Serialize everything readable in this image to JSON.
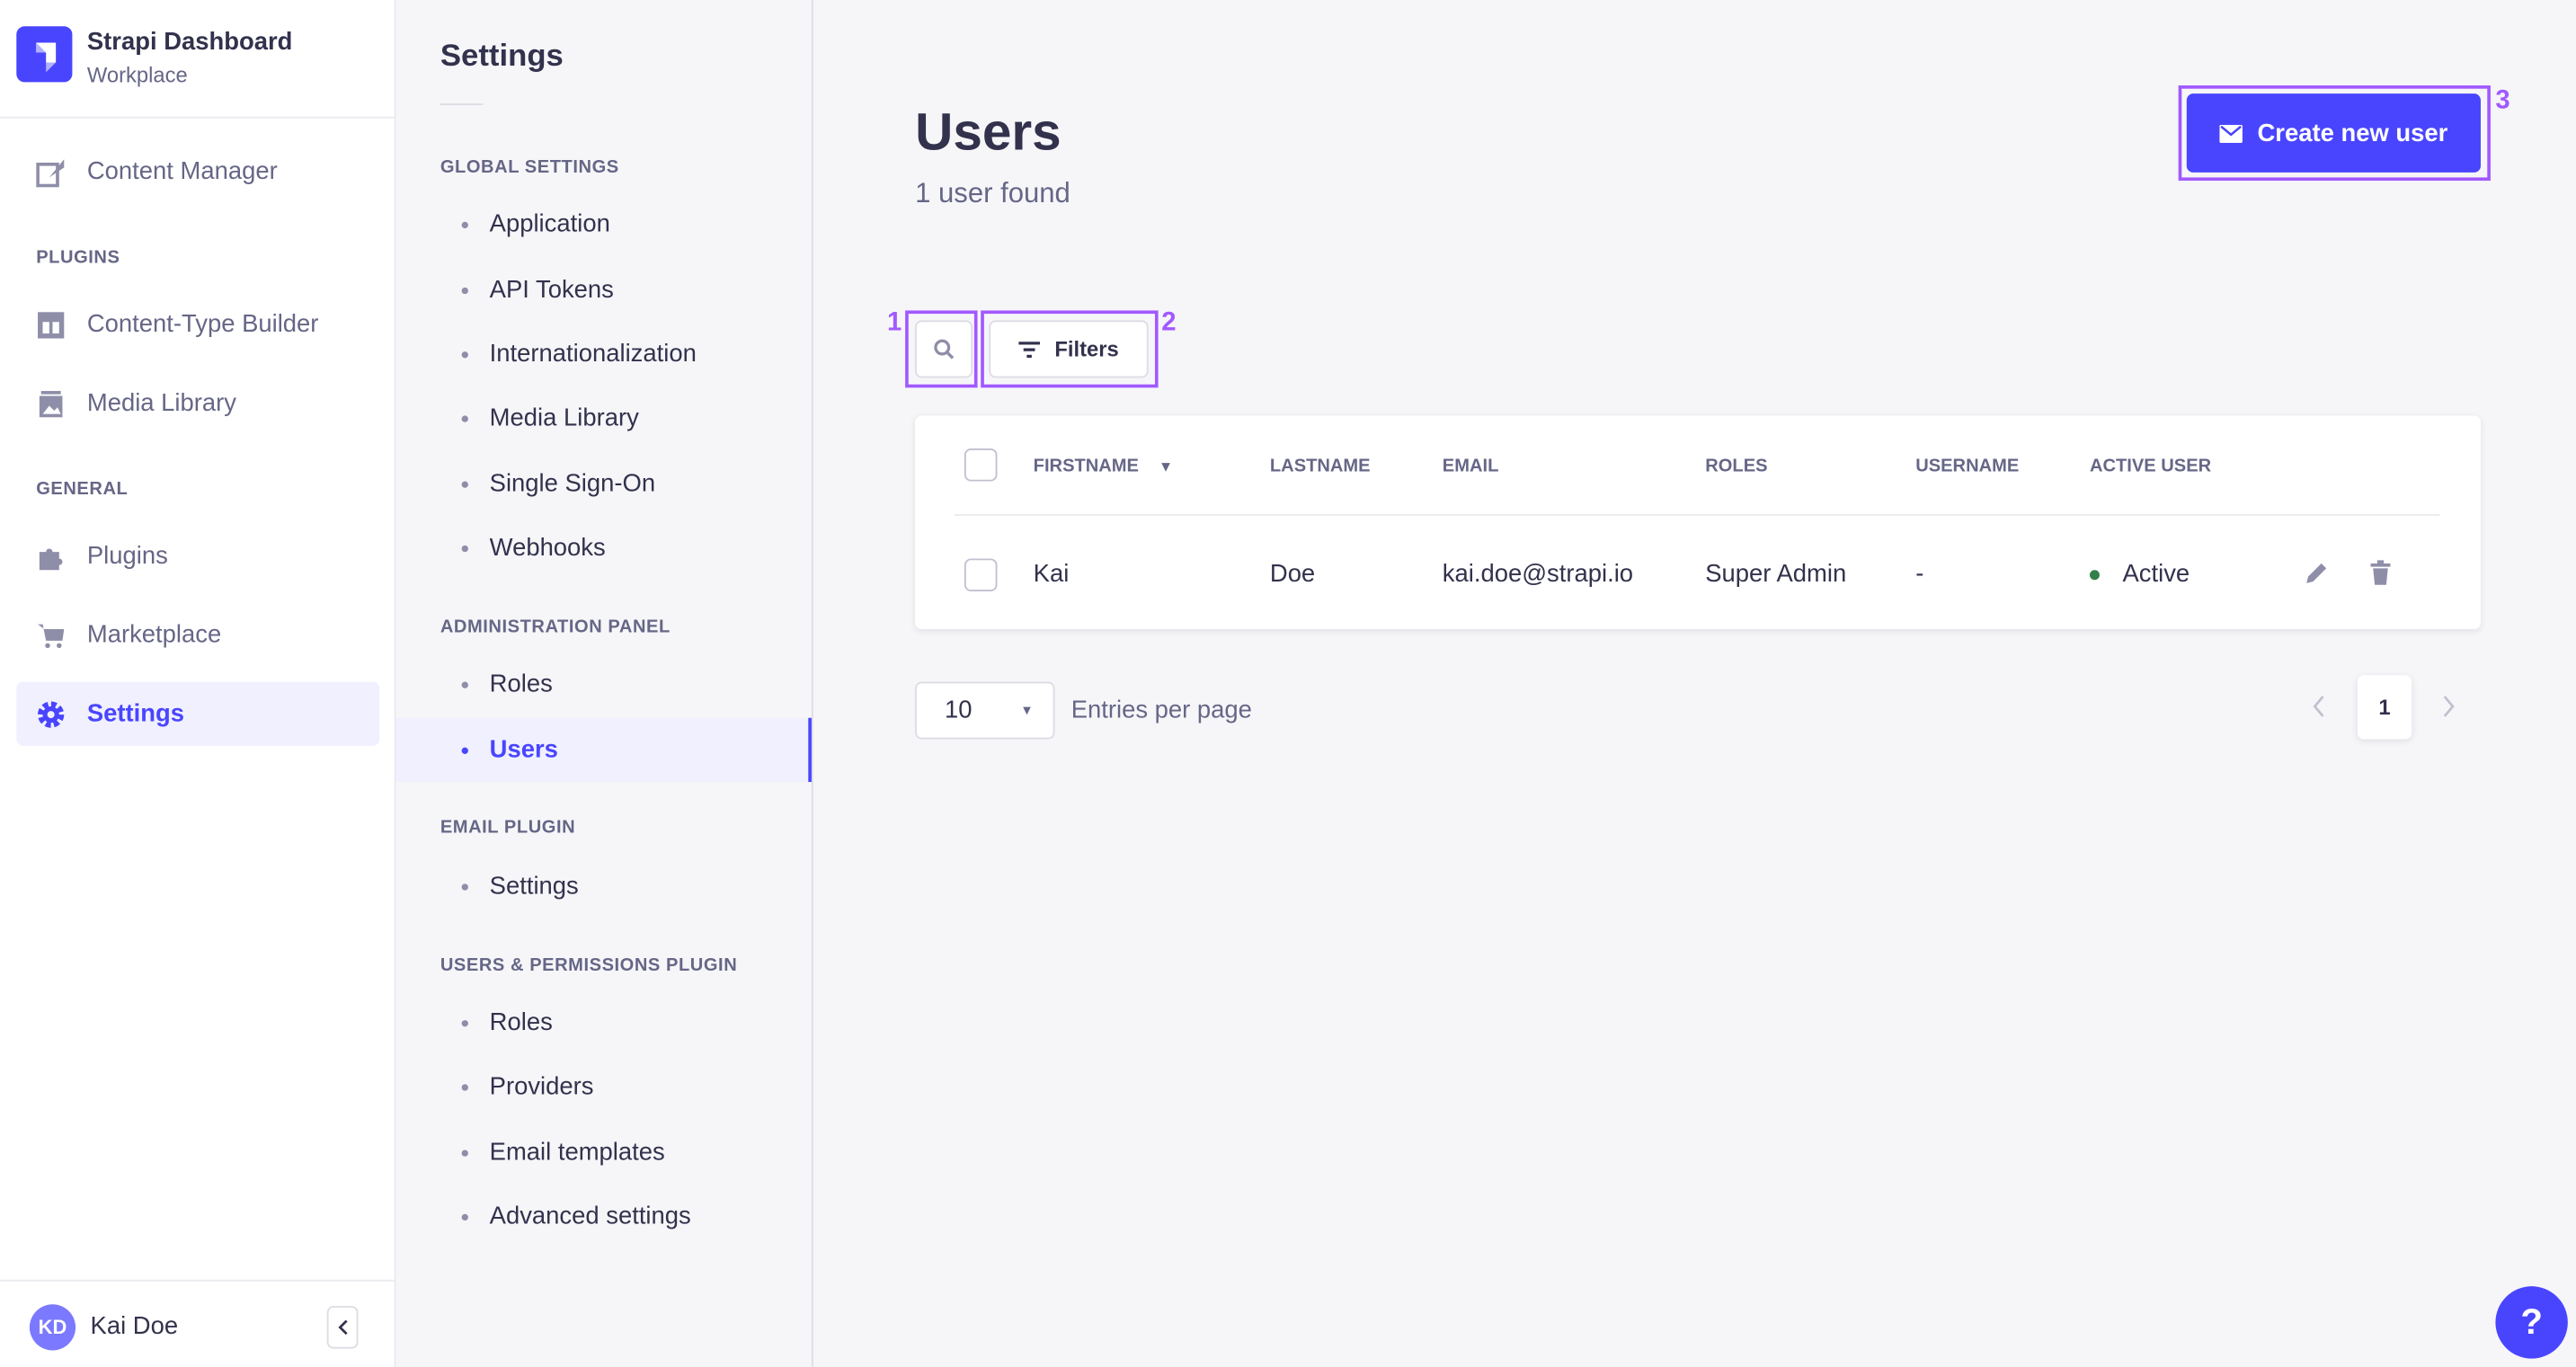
{
  "app": {
    "title": "Strapi Dashboard",
    "subtitle": "Workplace"
  },
  "nav": {
    "items": [
      {
        "label": "Content Manager",
        "icon": "feather-icon"
      }
    ],
    "plugins_label": "PLUGINS",
    "plugins": [
      {
        "label": "Content-Type Builder",
        "icon": "layout-icon"
      },
      {
        "label": "Media Library",
        "icon": "image-icon"
      }
    ],
    "general_label": "GENERAL",
    "general": [
      {
        "label": "Plugins",
        "icon": "puzzle-icon"
      },
      {
        "label": "Marketplace",
        "icon": "cart-icon"
      },
      {
        "label": "Settings",
        "icon": "gear-icon",
        "active": true
      }
    ],
    "user": {
      "initials": "KD",
      "name": "Kai Doe"
    }
  },
  "settings": {
    "title": "Settings",
    "sections": [
      {
        "label": "GLOBAL SETTINGS",
        "items": [
          "Application",
          "API Tokens",
          "Internationalization",
          "Media Library",
          "Single Sign-On",
          "Webhooks"
        ]
      },
      {
        "label": "ADMINISTRATION PANEL",
        "items": [
          "Roles",
          "Users"
        ]
      },
      {
        "label": "EMAIL PLUGIN",
        "items": [
          "Settings"
        ]
      },
      {
        "label": "USERS & PERMISSIONS PLUGIN",
        "items": [
          "Roles",
          "Providers",
          "Email templates",
          "Advanced settings"
        ]
      }
    ],
    "active": "Users"
  },
  "main": {
    "title": "Users",
    "subtitle": "1 user found",
    "create_label": "Create new user",
    "filters_label": "Filters",
    "annotations": [
      "1",
      "2",
      "3"
    ],
    "table": {
      "headers": [
        "FIRSTNAME",
        "LASTNAME",
        "EMAIL",
        "ROLES",
        "USERNAME",
        "ACTIVE USER"
      ],
      "rows": [
        {
          "firstname": "Kai",
          "lastname": "Doe",
          "email": "kai.doe@strapi.io",
          "roles": "Super Admin",
          "username": "-",
          "active": "Active"
        }
      ]
    },
    "pagination": {
      "per_page": "10",
      "per_page_label": "Entries per page",
      "current_page": "1"
    }
  },
  "help_label": "?",
  "colors": {
    "accent": "#4945ff",
    "annotation": "#a259ff",
    "active_dot": "#328048"
  }
}
